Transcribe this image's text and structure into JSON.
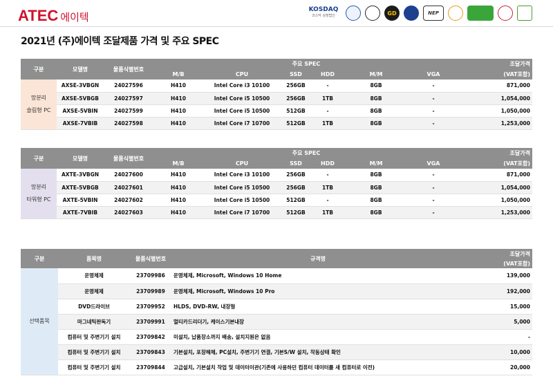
{
  "brand": {
    "mark": "ATEC",
    "korean": "에이텍"
  },
  "badges": [
    "KOSDAQ",
    "코스닥 상장법인",
    "GD",
    "NEP"
  ],
  "title": "2021년 (주)에이텍 조달제품 가격 및 주요 SPEC",
  "spec_headers": {
    "group": "구분",
    "model": "모델명",
    "id": "물품식별번호",
    "spec": "주요 SPEC",
    "price_top": "조달가격",
    "price_bottom": "(VAT포함)",
    "mb": "M/B",
    "cpu": "CPU",
    "ssd": "SSD",
    "hdd": "HDD",
    "mm": "M/M",
    "vga": "VGA"
  },
  "table1": {
    "group_line1": "망분리",
    "group_line2": "슬림형 PC",
    "rows": [
      {
        "model": "AXSE-3VBGN",
        "id": "24027596",
        "mb": "H410",
        "cpu": "Intel Core i3 10100",
        "ssd": "256GB",
        "hdd": "-",
        "mm": "8GB",
        "vga": "-",
        "price": "871,000"
      },
      {
        "model": "AXSE-5VBGB",
        "id": "24027597",
        "mb": "H410",
        "cpu": "Intel Core i5 10500",
        "ssd": "256GB",
        "hdd": "1TB",
        "mm": "8GB",
        "vga": "-",
        "price": "1,054,000"
      },
      {
        "model": "AXSE-5VBIN",
        "id": "24027599",
        "mb": "H410",
        "cpu": "Intel Core i5 10500",
        "ssd": "512GB",
        "hdd": "-",
        "mm": "8GB",
        "vga": "-",
        "price": "1,050,000"
      },
      {
        "model": "AXSE-7VBIB",
        "id": "24027598",
        "mb": "H410",
        "cpu": "Intel Core i7 10700",
        "ssd": "512GB",
        "hdd": "1TB",
        "mm": "8GB",
        "vga": "-",
        "price": "1,253,000"
      }
    ]
  },
  "table2": {
    "group_line1": "망분리",
    "group_line2": "타워형 PC",
    "rows": [
      {
        "model": "AXTE-3VBGN",
        "id": "24027600",
        "mb": "H410",
        "cpu": "Intel Core i3 10100",
        "ssd": "256GB",
        "hdd": "-",
        "mm": "8GB",
        "vga": "-",
        "price": "871,000"
      },
      {
        "model": "AXTE-5VBGB",
        "id": "24027601",
        "mb": "H410",
        "cpu": "Intel Core i5 10500",
        "ssd": "256GB",
        "hdd": "1TB",
        "mm": "8GB",
        "vga": "-",
        "price": "1,054,000"
      },
      {
        "model": "AXTE-5VBIN",
        "id": "24027602",
        "mb": "H410",
        "cpu": "Intel Core i5 10500",
        "ssd": "512GB",
        "hdd": "-",
        "mm": "8GB",
        "vga": "-",
        "price": "1,050,000"
      },
      {
        "model": "AXTE-7VBIB",
        "id": "24027603",
        "mb": "H410",
        "cpu": "Intel Core i7 10700",
        "ssd": "512GB",
        "hdd": "1TB",
        "mm": "8GB",
        "vga": "-",
        "price": "1,253,000"
      }
    ]
  },
  "table3": {
    "headers": {
      "group": "구분",
      "item": "품목명",
      "id": "물품식별번호",
      "spec": "규격명",
      "price_top": "조달가격",
      "price_bottom": "(VAT포함)"
    },
    "group": "선택품목",
    "rows": [
      {
        "item": "운영체제",
        "id": "23709986",
        "spec": "운영체제, Microsoft, Windows 10 Home",
        "price": "139,000"
      },
      {
        "item": "운영체제",
        "id": "23709989",
        "spec": "운영체제, Microsoft, Windows 10 Pro",
        "price": "192,000"
      },
      {
        "item": "DVD드라이브",
        "id": "23709952",
        "spec": "HLDS, DVD-RW, 내장형",
        "price": "15,000"
      },
      {
        "item": "마그네틱판독기",
        "id": "23709991",
        "spec": "멀티카드리더기, 케이스기본내장",
        "price": "5,000"
      },
      {
        "item": "컴퓨터 및 주변기기 설치",
        "id": "23709842",
        "spec": "미설치, 납품장소까지 배송, 설치지원은 없음",
        "price": "-"
      },
      {
        "item": "컴퓨터 및 주변기기 설치",
        "id": "23709843",
        "spec": "기본설치, 포장해체, PC설치, 주변기기 연결, 기본S/W 설치, 작동상태 확인",
        "price": "10,000"
      },
      {
        "item": "컴퓨터 및 주변기기 설치",
        "id": "23709844",
        "spec": "고급설치, 기본설치 작업 및 데이터이관(기존에 사용하던 컴퓨터 데이터를 새 컴퓨터로 이전)",
        "price": "20,000"
      }
    ]
  }
}
